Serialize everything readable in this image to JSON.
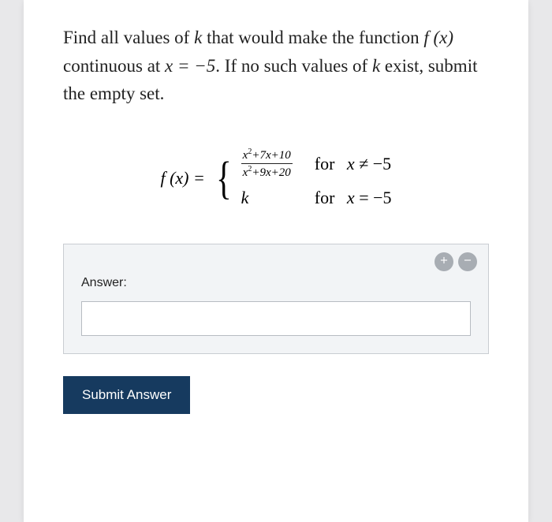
{
  "question": {
    "pre": "Find all values of ",
    "var_k": "k",
    "mid1": " that would make the function ",
    "fn": "f (x)",
    "mid2": " continuous at ",
    "eq": "x = −5",
    "mid3": ". If no such values of ",
    "var_k2": "k",
    "tail": " exist, submit the empty set."
  },
  "definition": {
    "lhs": "f (x) =",
    "piece1_num": "x² + 7x + 10",
    "piece1_den": "x² + 9x + 20",
    "piece2": "k",
    "cond1_for": "for",
    "cond1_expr": "x ≠ −5",
    "cond2_for": "for",
    "cond2_expr": "x = −5"
  },
  "answer": {
    "label": "Answer:",
    "value": "",
    "placeholder": ""
  },
  "buttons": {
    "submit": "Submit Answer"
  },
  "chart_data": {
    "type": "table",
    "title": "Piecewise function definition",
    "rows": [
      {
        "expression": "(x^2 + 7x + 10)/(x^2 + 9x + 20)",
        "condition": "x ≠ -5"
      },
      {
        "expression": "k",
        "condition": "x = -5"
      }
    ],
    "target_point": -5
  }
}
